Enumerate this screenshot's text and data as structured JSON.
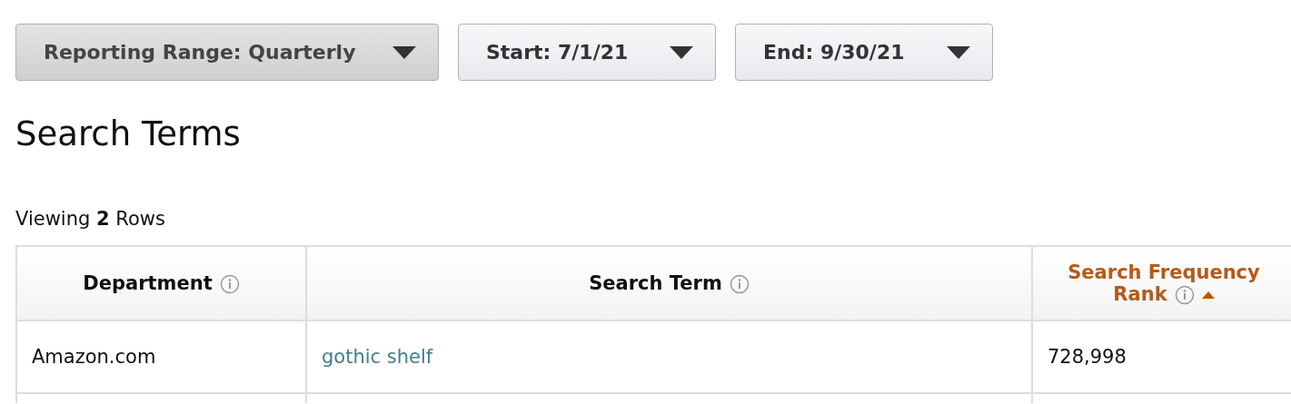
{
  "filters": [
    {
      "label": "Reporting Range: Quarterly",
      "selected": true
    },
    {
      "label": "Start: 7/1/21",
      "selected": false
    },
    {
      "label": "End: 9/30/21",
      "selected": false
    }
  ],
  "title": "Search Terms",
  "viewing": "Viewing **2** Rows",
  "table": {
    "columns": [
      {
        "label": "Department",
        "sorted": false
      },
      {
        "label": "Search Term",
        "sorted": false
      },
      {
        "label": "Search Frequency Rank",
        "sorted": true
      }
    ],
    "rows": [
      {
        "cells": [
          {
            "text": "Amazon.com",
            "kind": "text"
          },
          {
            "text": "gothic shelf",
            "kind": "link"
          },
          {
            "text": "728,998",
            "kind": "text"
          }
        ]
      }
    ]
  }
}
